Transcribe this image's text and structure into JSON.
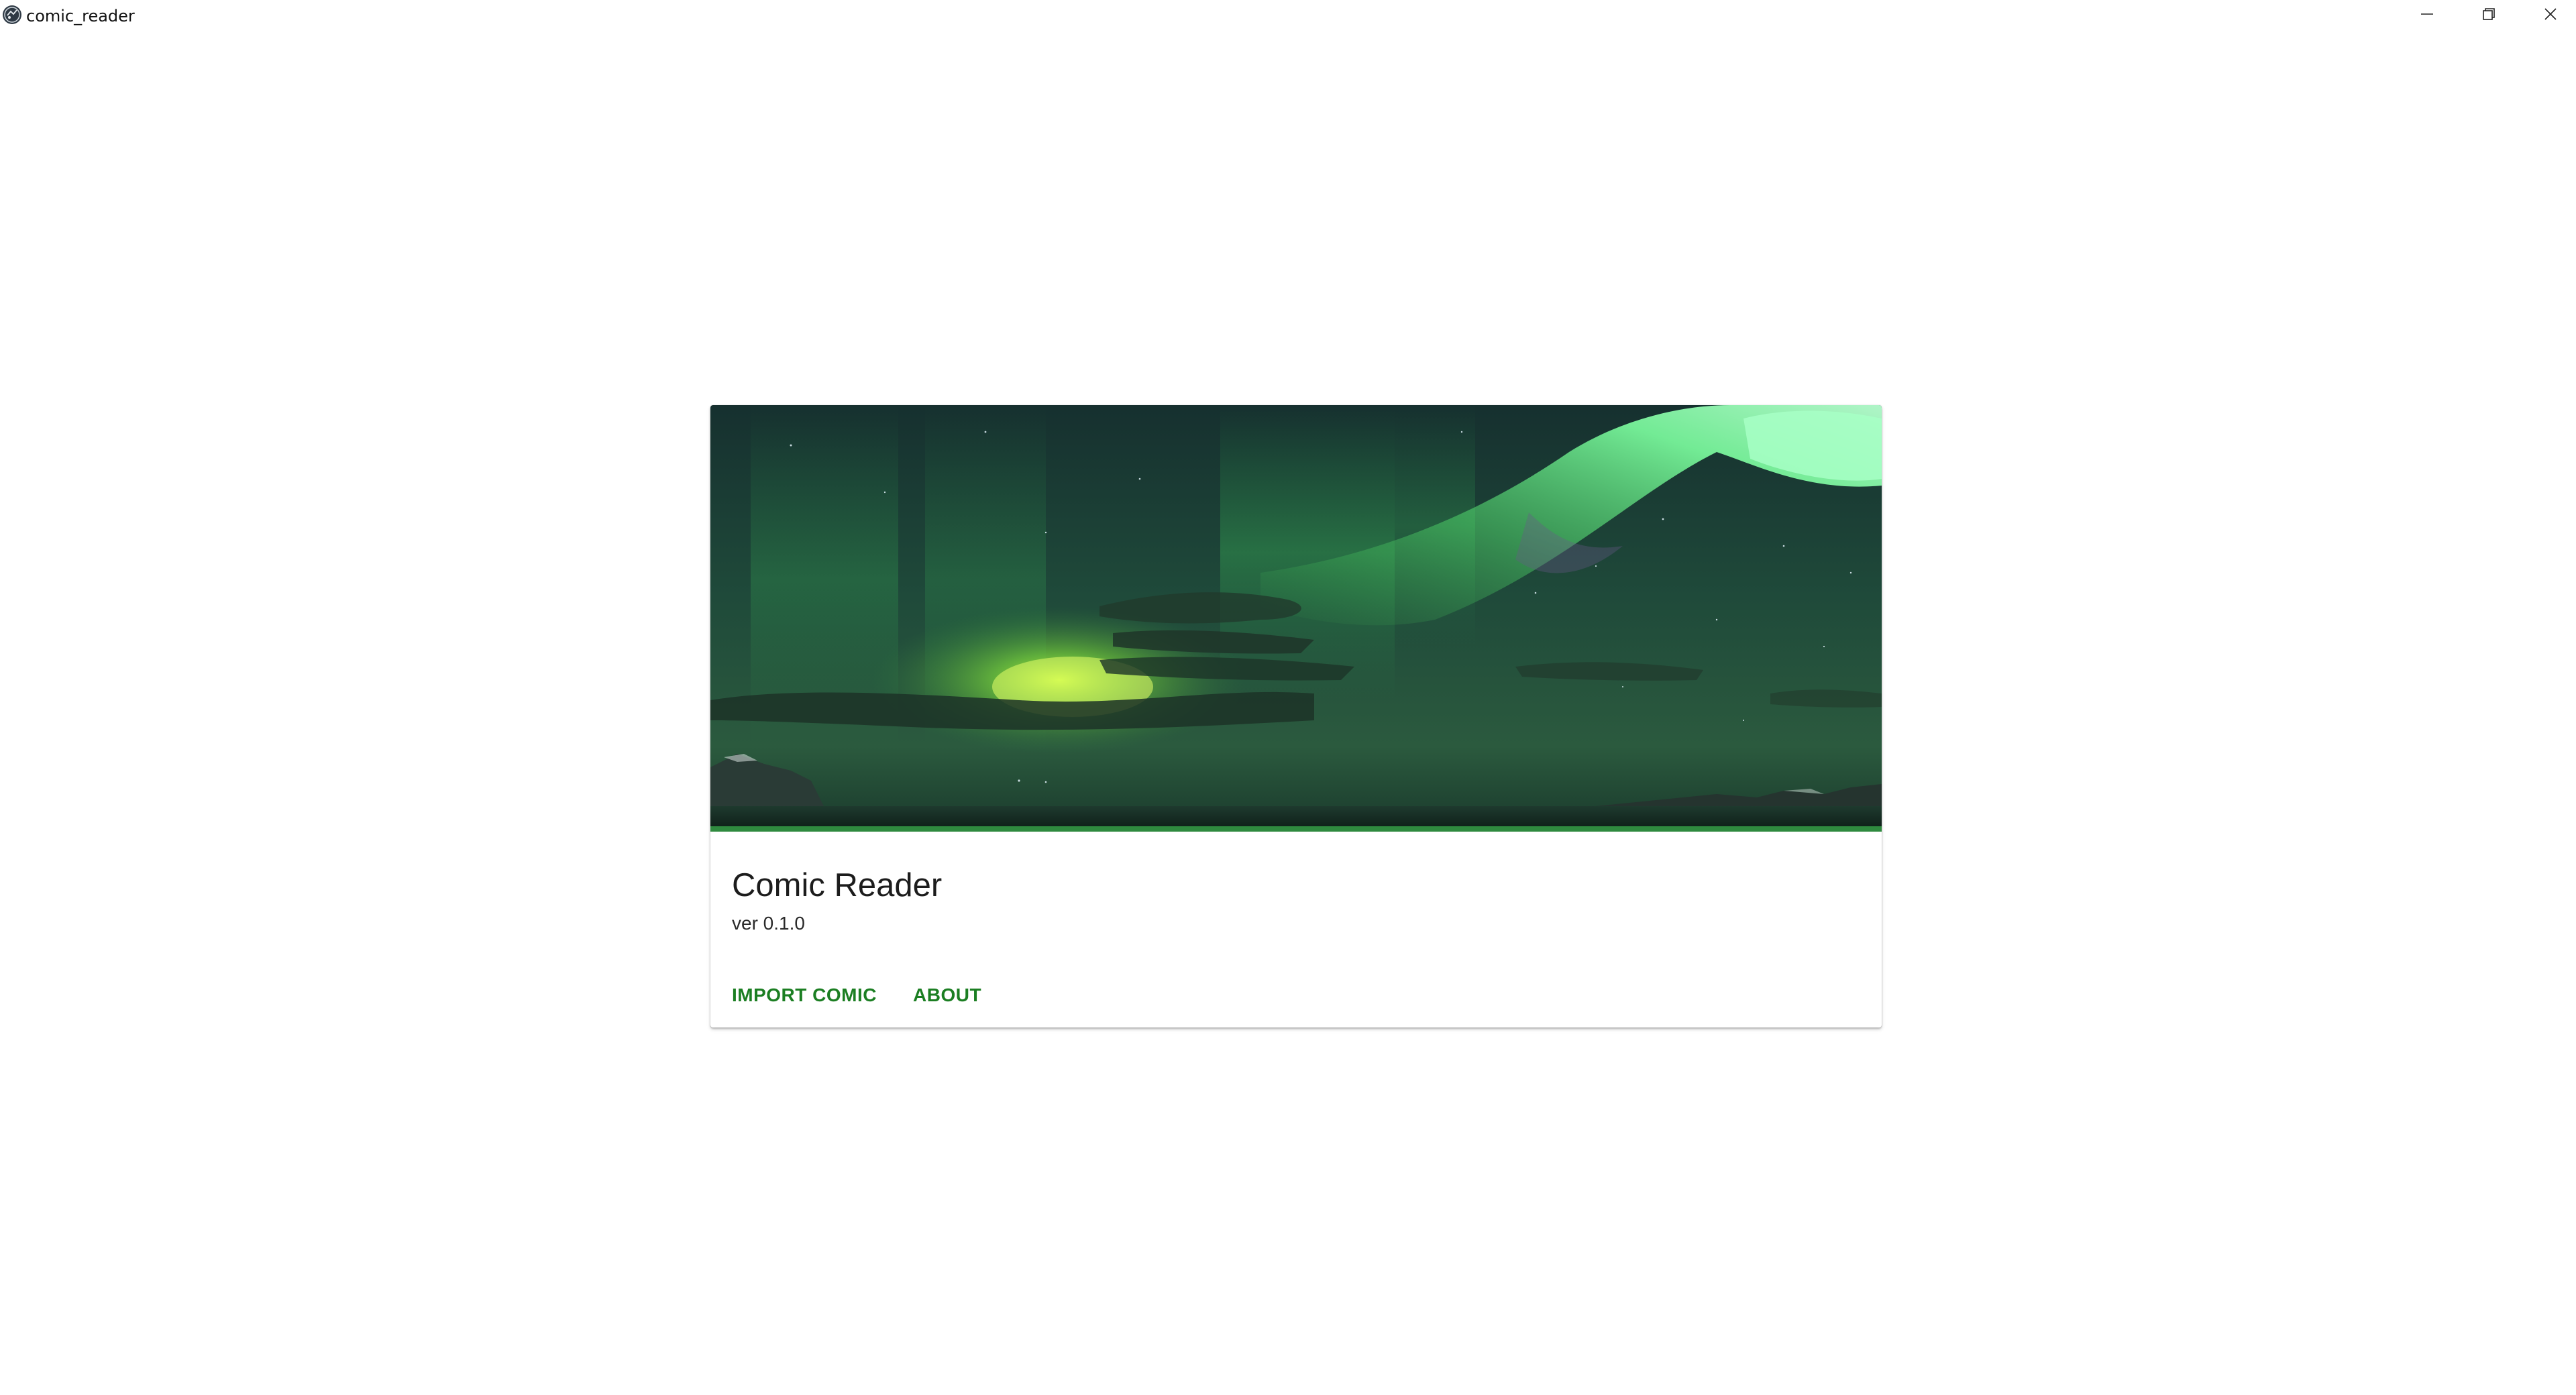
{
  "window": {
    "title": "comic_reader",
    "icon": "app-logo-icon",
    "controls": [
      "minimize-icon",
      "restore-icon",
      "close-icon"
    ]
  },
  "card": {
    "image": "aurora-landscape",
    "title": "Comic Reader",
    "subtitle": "ver 0.1.0",
    "actions": {
      "import_label": "IMPORT COMIC",
      "about_label": "ABOUT"
    }
  },
  "colors": {
    "accent": "#1b7e22",
    "background": "#ffffff"
  }
}
